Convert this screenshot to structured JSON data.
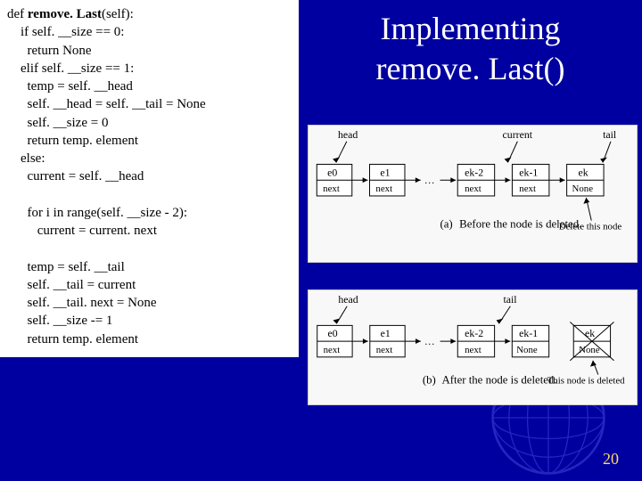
{
  "title_line1": "Implementing",
  "title_line2": "remove. Last()",
  "code": {
    "l1a": "def ",
    "l1b": "remove. Last",
    "l1c": "(self):",
    "l2": "    if self. __size == 0:",
    "l3": "      return None",
    "l4": "    elif self. __size == 1:",
    "l5": "      temp = self. __head",
    "l6": "      self. __head = self. __tail = None",
    "l7": "      self. __size = 0",
    "l8": "      return temp. element",
    "l9": "    else:",
    "l10": "      current = self. __head",
    "l11": "",
    "l12": "      for i in range(self. __size - 2):",
    "l13": "         current = current. next",
    "l14": "",
    "l15": "      temp = self. __tail",
    "l16": "      self. __tail = current",
    "l17": "      self. __tail. next = None",
    "l18": "      self. __size -= 1",
    "l19": "      return temp. element"
  },
  "diagram_a": {
    "tag": "(a)",
    "caption": "Before the node is deleted.",
    "head": "head",
    "current": "current",
    "tail": "tail",
    "e0": "e0",
    "e1": "e1",
    "ek2": "ek-2",
    "ek1": "ek-1",
    "ek": "ek",
    "next": "next",
    "none": "None",
    "dots": "…",
    "delete": "Delete this node"
  },
  "diagram_b": {
    "tag": "(b)",
    "caption": "After the node is deleted.",
    "head": "head",
    "tail": "tail",
    "e0": "e0",
    "e1": "e1",
    "ek2": "ek-2",
    "ek1": "ek-1",
    "ek": "ek",
    "next": "next",
    "none": "None",
    "dots": "…",
    "deleted": "This node is deleted"
  },
  "page_num": "20"
}
